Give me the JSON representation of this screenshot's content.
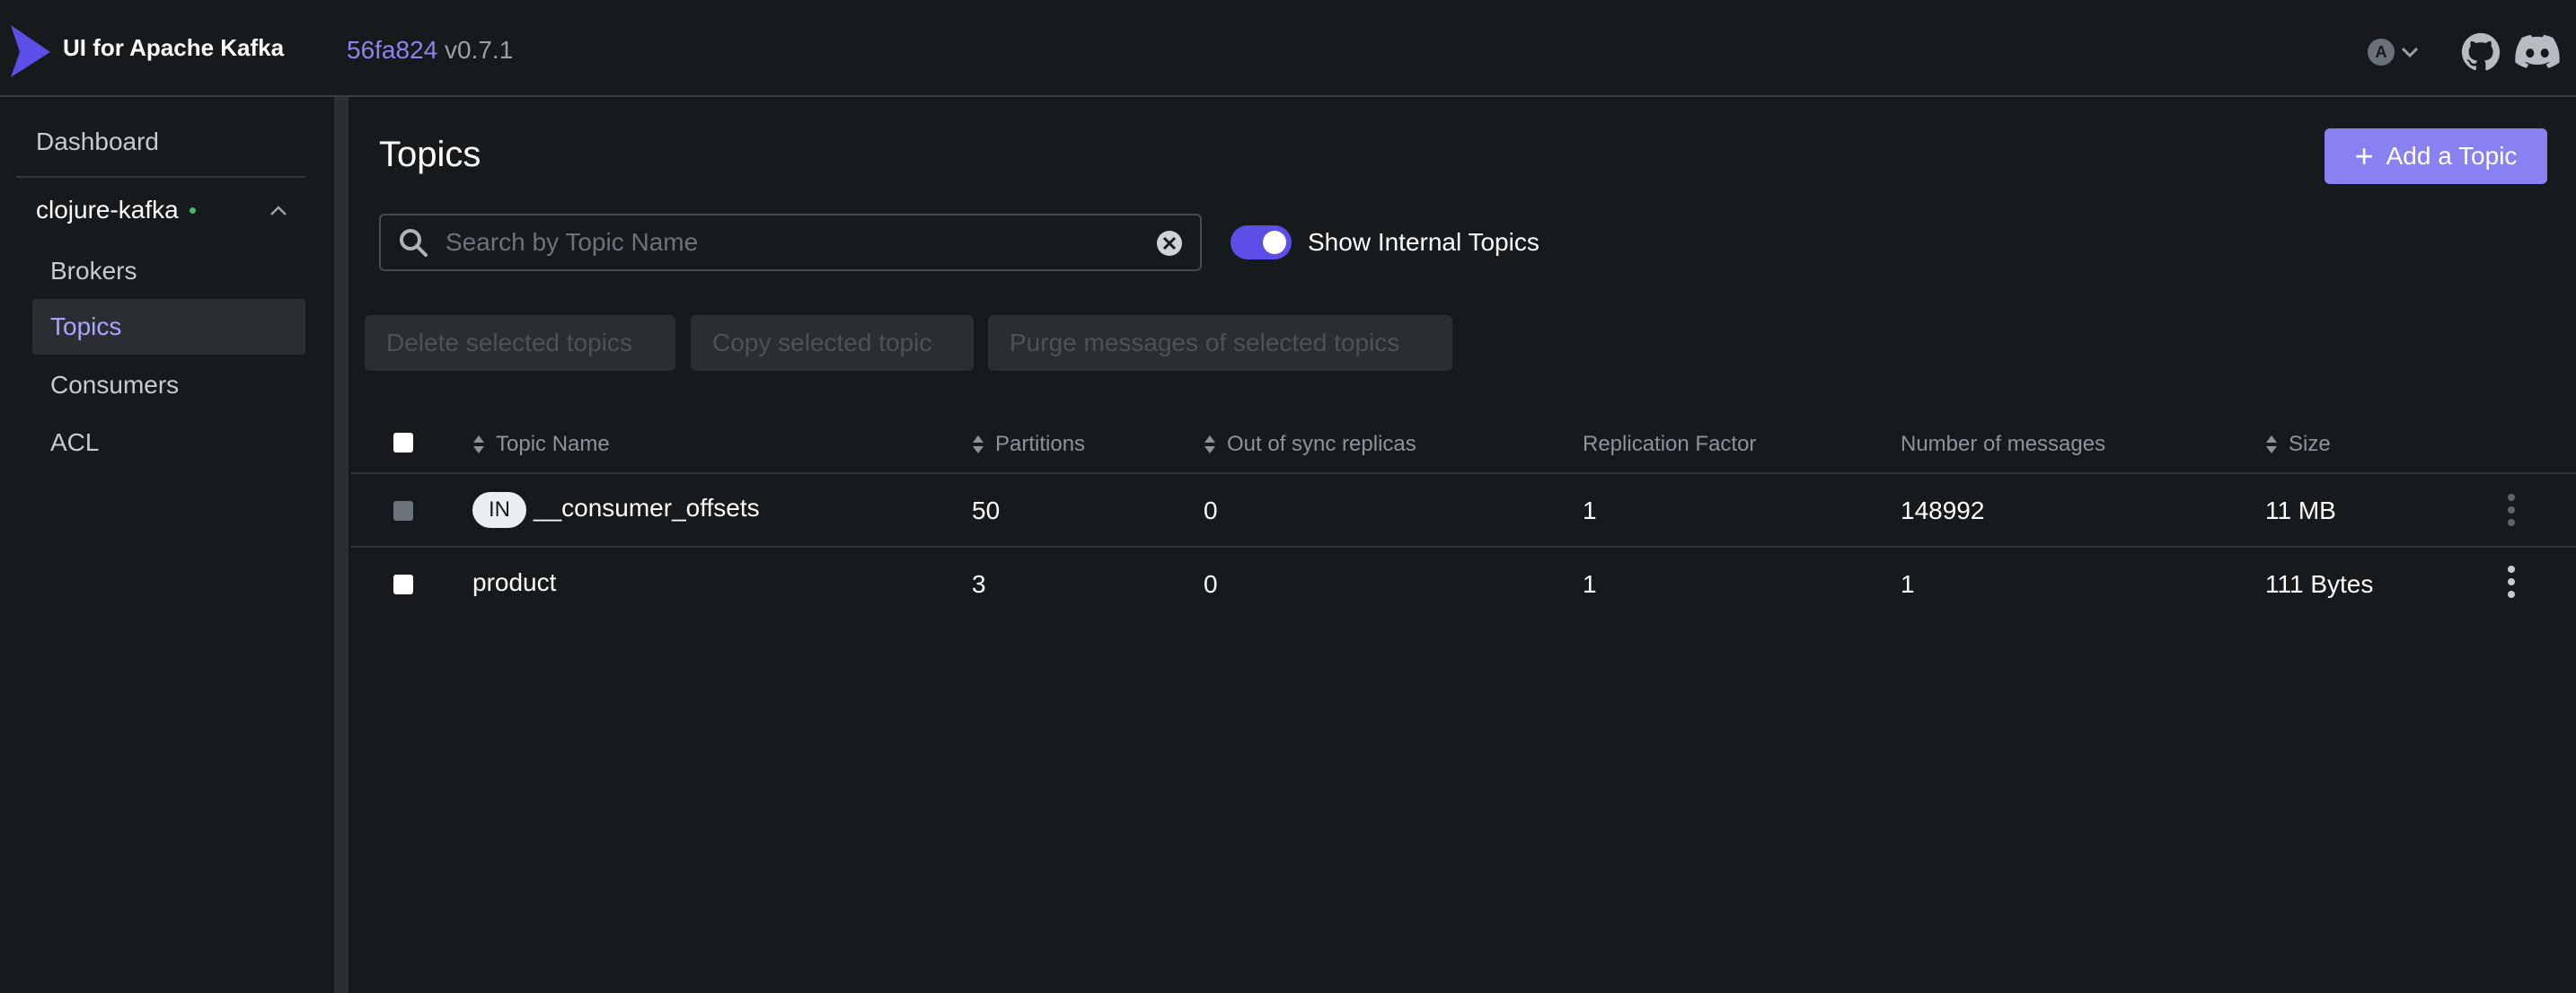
{
  "header": {
    "app_title": "UI for Apache Kafka",
    "commit": "56fa824",
    "version": "v0.7.1",
    "theme_letter": "A"
  },
  "sidebar": {
    "dashboard": "Dashboard",
    "cluster_name": "clojure-kafka",
    "items": [
      {
        "label": "Brokers",
        "active": false
      },
      {
        "label": "Topics",
        "active": true
      },
      {
        "label": "Consumers",
        "active": false
      },
      {
        "label": "ACL",
        "active": false
      }
    ]
  },
  "main": {
    "title": "Topics",
    "add_topic_label": "Add a Topic",
    "search_placeholder": "Search by Topic Name",
    "show_internal_label": "Show Internal Topics",
    "show_internal_on": true,
    "actions": {
      "delete": "Delete selected topics",
      "copy": "Copy selected topic",
      "purge": "Purge messages of selected topics"
    }
  },
  "table": {
    "columns": {
      "name": "Topic Name",
      "partitions": "Partitions",
      "out_of_sync": "Out of sync replicas",
      "replication": "Replication Factor",
      "messages": "Number of messages",
      "size": "Size"
    },
    "rows": [
      {
        "badge": "IN",
        "name": "__consumer_offsets",
        "partitions": "50",
        "out_of_sync": "0",
        "replication": "1",
        "messages": "148992",
        "size": "11 MB"
      },
      {
        "badge": "",
        "name": "product",
        "partitions": "3",
        "out_of_sync": "0",
        "replication": "1",
        "messages": "1",
        "size": "111 Bytes"
      }
    ]
  },
  "colors": {
    "accent": "#8981f2",
    "toggle": "#5b4fe8",
    "status_online": "#3fb96b",
    "background": "#171a1c"
  }
}
